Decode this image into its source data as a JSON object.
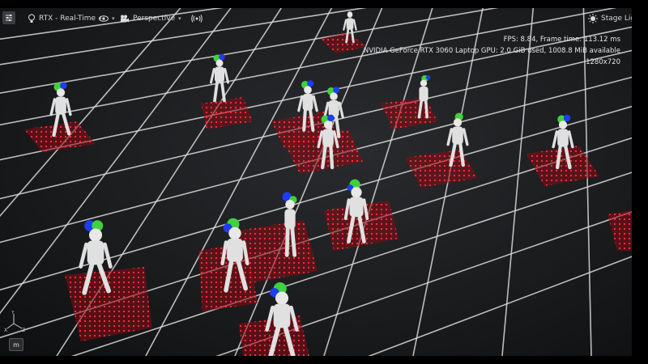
{
  "toolbar": {
    "renderer_label": "RTX - Real-Time",
    "camera_label": "Perspective",
    "stage_lights_label": "Stage Lights"
  },
  "stats": {
    "fps_line": "FPS: 8.84, Frame time: 113.12 ms",
    "gpu_line": "NVIDIA GeForce RTX 3060 Laptop GPU: 2.0 GiB used, 1008.8 MiB available",
    "resolution_line": "1280x720"
  },
  "corner": {
    "m_button_label": "m",
    "axis_x": "X",
    "axis_y": "Y",
    "axis_z": "Z"
  },
  "icons": {
    "menu": "settings-sliders-icon",
    "renderer": "lightbulb-icon",
    "visibility": "eye-icon",
    "camera": "movie-camera-icon",
    "audio": "broadcast-icon",
    "stage_lights": "sun-icon"
  },
  "colors": {
    "pad_red": "#d01c24",
    "robot_white": "#e8e8e8",
    "marker_green": "#3fd23c",
    "marker_blue": "#1f3df0"
  }
}
